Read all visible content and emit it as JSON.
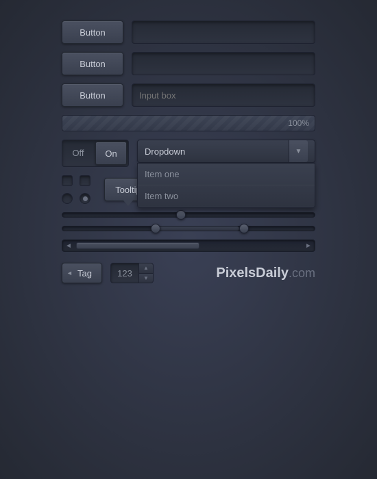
{
  "buttons": {
    "btn1_label": "Button",
    "btn2_label": "Button",
    "btn3_label": "Button"
  },
  "inputs": {
    "field1_placeholder": "",
    "field2_placeholder": "",
    "field3_placeholder": "Input box"
  },
  "progress": {
    "value": 100,
    "label": "100%"
  },
  "toggle": {
    "off_label": "Off",
    "on_label": "On"
  },
  "dropdown": {
    "label": "Dropdown",
    "item1": "Item one",
    "item2": "Item two"
  },
  "tooltip_btn": "Tooltip",
  "number_input": {
    "value": "123"
  },
  "brand": {
    "name": "PixelsDaily",
    "tld": ".com"
  },
  "tag": {
    "label": "Tag"
  },
  "sliders": {
    "slider1_pos": "45%",
    "slider2_left": "35%",
    "slider2_right": "70%"
  }
}
